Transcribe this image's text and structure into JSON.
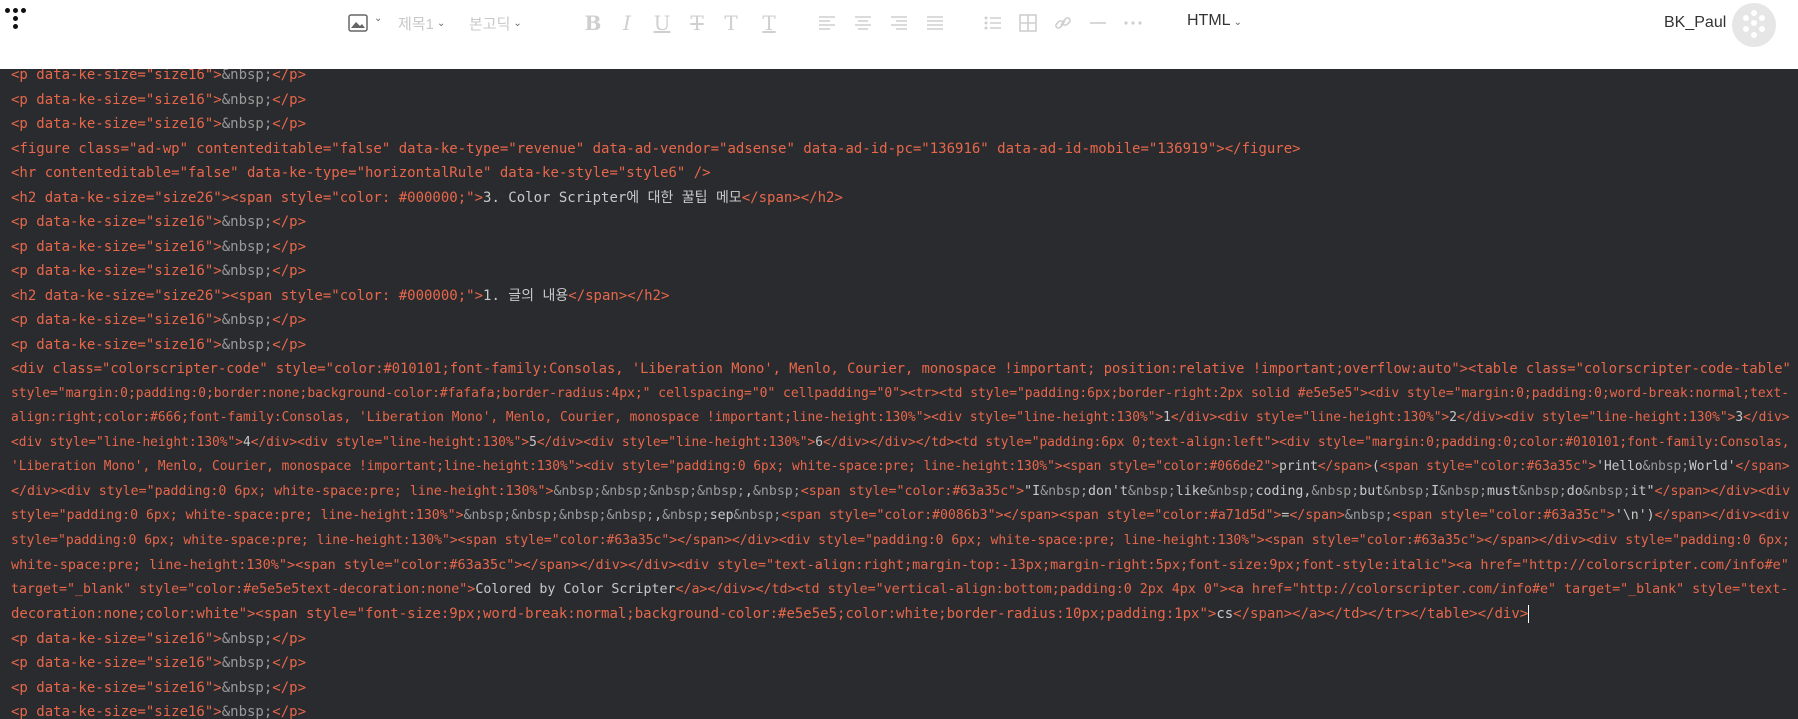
{
  "toolbar": {
    "image_caret": "⌄",
    "heading_label": "제목1",
    "font_label": "본고딕",
    "html_mode_label": "HTML",
    "user_name": "BK_Paul"
  },
  "editor": {
    "lines": [
      {
        "segments": [
          {
            "c": "tag",
            "t": "<p data-ke-size=\"size16\">"
          },
          {
            "c": "ent",
            "t": "&nbsp;"
          },
          {
            "c": "tag",
            "t": "</p>"
          }
        ]
      },
      {
        "segments": [
          {
            "c": "tag",
            "t": "<p data-ke-size=\"size16\">"
          },
          {
            "c": "ent",
            "t": "&nbsp;"
          },
          {
            "c": "tag",
            "t": "</p>"
          }
        ]
      },
      {
        "segments": [
          {
            "c": "tag",
            "t": "<p data-ke-size=\"size16\">"
          },
          {
            "c": "ent",
            "t": "&nbsp;"
          },
          {
            "c": "tag",
            "t": "</p>"
          }
        ]
      },
      {
        "segments": [
          {
            "c": "tag",
            "t": "<figure class=\"ad-wp\" contenteditable=\"false\" data-ke-type=\"revenue\" data-ad-vendor=\"adsense\" data-ad-id-pc=\"136916\" data-ad-id-mobile=\"136919\"></figure>"
          }
        ]
      },
      {
        "segments": [
          {
            "c": "tag",
            "t": "<hr contenteditable=\"false\" data-ke-type=\"horizontalRule\" data-ke-style=\"style6\" />"
          }
        ]
      },
      {
        "segments": [
          {
            "c": "tag",
            "t": "<h2 data-ke-size=\"size26\"><span style=\"color: #000000;\">"
          },
          {
            "c": "txt",
            "t": "3. Color Scripter에 대한 꿀팁 메모"
          },
          {
            "c": "tag",
            "t": "</span></h2>"
          }
        ]
      },
      {
        "segments": [
          {
            "c": "tag",
            "t": "<p data-ke-size=\"size16\">"
          },
          {
            "c": "ent",
            "t": "&nbsp;"
          },
          {
            "c": "tag",
            "t": "</p>"
          }
        ]
      },
      {
        "segments": [
          {
            "c": "tag",
            "t": "<p data-ke-size=\"size16\">"
          },
          {
            "c": "ent",
            "t": "&nbsp;"
          },
          {
            "c": "tag",
            "t": "</p>"
          }
        ]
      },
      {
        "segments": [
          {
            "c": "tag",
            "t": "<p data-ke-size=\"size16\">"
          },
          {
            "c": "ent",
            "t": "&nbsp;"
          },
          {
            "c": "tag",
            "t": "</p>"
          }
        ]
      },
      {
        "segments": [
          {
            "c": "tag",
            "t": "<h2 data-ke-size=\"size26\"><span style=\"color: #000000;\">"
          },
          {
            "c": "txt",
            "t": "1. 글의 내용"
          },
          {
            "c": "tag",
            "t": "</span></h2>"
          }
        ]
      },
      {
        "segments": [
          {
            "c": "tag",
            "t": "<p data-ke-size=\"size16\">"
          },
          {
            "c": "ent",
            "t": "&nbsp;"
          },
          {
            "c": "tag",
            "t": "</p>"
          }
        ]
      },
      {
        "segments": [
          {
            "c": "tag",
            "t": "<p data-ke-size=\"size16\">"
          },
          {
            "c": "ent",
            "t": "&nbsp;"
          },
          {
            "c": "tag",
            "t": "</p>"
          }
        ]
      },
      {
        "segments": [
          {
            "c": "tag",
            "t": "<div class=\"colorscripter-code\" style=\"color:#010101;font-family:Consolas, 'Liberation Mono', Menlo, Courier, monospace !important; position:relative !important;overflow:auto\"><table class=\"colorscripter-code-table\""
          }
        ]
      },
      {
        "segments": [
          {
            "c": "tag",
            "t": "style=\"margin:0;padding:0;border:none;background-color:#fafafa;border-radius:4px;\" cellspacing=\"0\" cellpadding=\"0\"><tr><td style=\"padding:6px;border-right:2px solid #e5e5e5\"><div style=\"margin:0;padding:0;word-break:normal;text-"
          }
        ]
      },
      {
        "segments": [
          {
            "c": "tag",
            "t": "align:right;color:#666;font-family:Consolas, 'Liberation Mono', Menlo, Courier, monospace !important;line-height:130%\"><div style=\"line-height:130%\">"
          },
          {
            "c": "txt",
            "t": "1"
          },
          {
            "c": "tag",
            "t": "</div><div style=\"line-height:130%\">"
          },
          {
            "c": "txt",
            "t": "2"
          },
          {
            "c": "tag",
            "t": "</div><div style=\"line-height:130%\">"
          },
          {
            "c": "txt",
            "t": "3"
          },
          {
            "c": "tag",
            "t": "</div>"
          }
        ]
      },
      {
        "segments": [
          {
            "c": "tag",
            "t": "<div style=\"line-height:130%\">"
          },
          {
            "c": "txt",
            "t": "4"
          },
          {
            "c": "tag",
            "t": "</div><div style=\"line-height:130%\">"
          },
          {
            "c": "txt",
            "t": "5"
          },
          {
            "c": "tag",
            "t": "</div><div style=\"line-height:130%\">"
          },
          {
            "c": "txt",
            "t": "6"
          },
          {
            "c": "tag",
            "t": "</div></div></td><td style=\"padding:6px 0;text-align:left\"><div style=\"margin:0;padding:0;color:#010101;font-family:Consolas,"
          }
        ]
      },
      {
        "segments": [
          {
            "c": "tag",
            "t": "'Liberation Mono', Menlo, Courier, monospace !important;line-height:130%\"><div style=\"padding:0 6px; white-space:pre; line-height:130%\"><span style=\"color:#066de2\">"
          },
          {
            "c": "txt",
            "t": "print"
          },
          {
            "c": "tag",
            "t": "</span>"
          },
          {
            "c": "txt",
            "t": "("
          },
          {
            "c": "tag",
            "t": "<span style=\"color:#63a35c\">"
          },
          {
            "c": "txt",
            "t": "'Hello"
          },
          {
            "c": "ent",
            "t": "&nbsp;"
          },
          {
            "c": "txt",
            "t": "World'"
          },
          {
            "c": "tag",
            "t": "</span>"
          }
        ]
      },
      {
        "segments": [
          {
            "c": "tag",
            "t": "</div><div style=\"padding:0 6px; white-space:pre; line-height:130%\">"
          },
          {
            "c": "ent",
            "t": "&nbsp;&nbsp;&nbsp;&nbsp;"
          },
          {
            "c": "txt",
            "t": ","
          },
          {
            "c": "ent",
            "t": "&nbsp;"
          },
          {
            "c": "tag",
            "t": "<span style=\"color:#63a35c\">"
          },
          {
            "c": "txt",
            "t": "\"I"
          },
          {
            "c": "ent",
            "t": "&nbsp;"
          },
          {
            "c": "txt",
            "t": "don't"
          },
          {
            "c": "ent",
            "t": "&nbsp;"
          },
          {
            "c": "txt",
            "t": "like"
          },
          {
            "c": "ent",
            "t": "&nbsp;"
          },
          {
            "c": "txt",
            "t": "coding,"
          },
          {
            "c": "ent",
            "t": "&nbsp;"
          },
          {
            "c": "txt",
            "t": "but"
          },
          {
            "c": "ent",
            "t": "&nbsp;"
          },
          {
            "c": "txt",
            "t": "I"
          },
          {
            "c": "ent",
            "t": "&nbsp;"
          },
          {
            "c": "txt",
            "t": "must"
          },
          {
            "c": "ent",
            "t": "&nbsp;"
          },
          {
            "c": "txt",
            "t": "do"
          },
          {
            "c": "ent",
            "t": "&nbsp;"
          },
          {
            "c": "txt",
            "t": "it\""
          },
          {
            "c": "tag",
            "t": "</span></div><div"
          }
        ]
      },
      {
        "segments": [
          {
            "c": "tag",
            "t": "style=\"padding:0 6px; white-space:pre; line-height:130%\">"
          },
          {
            "c": "ent",
            "t": "&nbsp;&nbsp;&nbsp;&nbsp;"
          },
          {
            "c": "txt",
            "t": ","
          },
          {
            "c": "ent",
            "t": "&nbsp;"
          },
          {
            "c": "txt",
            "t": "sep"
          },
          {
            "c": "ent",
            "t": "&nbsp;"
          },
          {
            "c": "tag",
            "t": "<span style=\"color:#0086b3\"></span><span style=\"color:#a71d5d\">"
          },
          {
            "c": "txt",
            "t": "="
          },
          {
            "c": "tag",
            "t": "</span>"
          },
          {
            "c": "ent",
            "t": "&nbsp;"
          },
          {
            "c": "tag",
            "t": "<span style=\"color:#63a35c\">"
          },
          {
            "c": "txt",
            "t": "'\\n')"
          },
          {
            "c": "tag",
            "t": "</span></div><div"
          }
        ]
      },
      {
        "segments": [
          {
            "c": "tag",
            "t": "style=\"padding:0 6px; white-space:pre; line-height:130%\"><span style=\"color:#63a35c\"></span></div><div style=\"padding:0 6px; white-space:pre; line-height:130%\"><span style=\"color:#63a35c\"></span></div><div style=\"padding:0 6px;"
          }
        ]
      },
      {
        "segments": [
          {
            "c": "tag",
            "t": "white-space:pre; line-height:130%\"><span style=\"color:#63a35c\"></span></div></div><div style=\"text-align:right;margin-top:-13px;margin-right:5px;font-size:9px;font-style:italic\"><a href=\"http://colorscripter.com/info#e\""
          }
        ]
      },
      {
        "segments": [
          {
            "c": "tag",
            "t": "target=\"_blank\" style=\"color:#e5e5e5text-decoration:none\">"
          },
          {
            "c": "txt",
            "t": "Colored by Color Scripter"
          },
          {
            "c": "tag",
            "t": "</a></div></td><td style=\"vertical-align:bottom;padding:0 2px 4px 0\"><a href=\"http://colorscripter.com/info#e\" target=\"_blank\" style=\"text-"
          }
        ]
      },
      {
        "segments": [
          {
            "c": "tag",
            "t": "decoration:none;color:white\"><span style=\"font-size:9px;word-break:normal;background-color:#e5e5e5;color:white;border-radius:10px;padding:1px\">"
          },
          {
            "c": "txt",
            "t": "cs"
          },
          {
            "c": "tag",
            "t": "</span></a></td></tr></table></div>"
          }
        ],
        "cursor": true
      },
      {
        "segments": [
          {
            "c": "tag",
            "t": "<p data-ke-size=\"size16\">"
          },
          {
            "c": "ent",
            "t": "&nbsp;"
          },
          {
            "c": "tag",
            "t": "</p>"
          }
        ]
      },
      {
        "segments": [
          {
            "c": "tag",
            "t": "<p data-ke-size=\"size16\">"
          },
          {
            "c": "ent",
            "t": "&nbsp;"
          },
          {
            "c": "tag",
            "t": "</p>"
          }
        ]
      },
      {
        "segments": [
          {
            "c": "tag",
            "t": "<p data-ke-size=\"size16\">"
          },
          {
            "c": "ent",
            "t": "&nbsp;"
          },
          {
            "c": "tag",
            "t": "</p>"
          }
        ]
      },
      {
        "segments": [
          {
            "c": "tag",
            "t": "<p data-ke-size=\"size16\">"
          },
          {
            "c": "ent",
            "t": "&nbsp;"
          },
          {
            "c": "tag",
            "t": "</p>"
          }
        ]
      }
    ]
  }
}
